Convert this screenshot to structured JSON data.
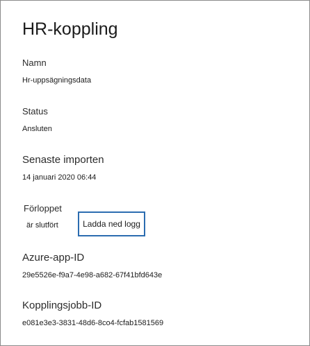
{
  "panel": {
    "title": "HR-koppling"
  },
  "fields": {
    "name": {
      "label": "Namn",
      "value": "Hr-uppsägningsdata"
    },
    "status": {
      "label": "Status",
      "value": "Ansluten"
    },
    "last_import": {
      "label": "Senaste importen",
      "value": "14 januari 2020 06:44"
    },
    "progress": {
      "label": "Förloppet",
      "value": "är slutfört",
      "download_button_label": "Ladda ned logg"
    },
    "azure_app_id": {
      "label": "Azure-app-ID",
      "value": "29e5526e-f9a7-4e98-a682-67f41bfd643e"
    },
    "connector_job_id": {
      "label": "Kopplingsjobb-ID",
      "value": "e081e3e3-3831-48d6-8co4-fcfab1581569"
    }
  },
  "colors": {
    "button_border": "#2b6cb0",
    "panel_border": "#8a8a8a",
    "text": "#1b1b1b"
  }
}
